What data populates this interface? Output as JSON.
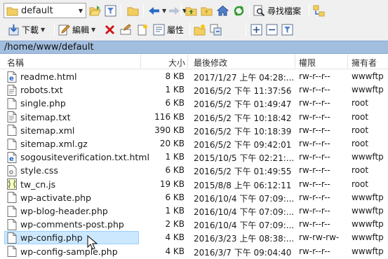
{
  "toolbar1": {
    "path_combo": {
      "value": "default",
      "icon": "folder-icon"
    },
    "search_label": "尋找檔案"
  },
  "toolbar2": {
    "download_label": "下載",
    "edit_label": "編輯",
    "properties_label": "屬性"
  },
  "path": "/home/www/default",
  "columns": {
    "name": "名稱",
    "size": "大小",
    "modified": "最後修改",
    "permissions": "權限",
    "owner": "擁有者"
  },
  "files": [
    {
      "name": "readme.html",
      "icon": "html-file-icon",
      "size": "8 KB",
      "modified": "2017/1/27 上午 04:28:...",
      "permissions": "rw-r--r--",
      "owner": "wwwftp"
    },
    {
      "name": "robots.txt",
      "icon": "text-file-icon",
      "size": "1 KB",
      "modified": "2016/5/2 下午 11:37:56",
      "permissions": "rw-r--r--",
      "owner": "wwwftp"
    },
    {
      "name": "single.php",
      "icon": "file-icon",
      "size": "6 KB",
      "modified": "2016/5/2 下午 01:49:47",
      "permissions": "rw-r--r--",
      "owner": "root"
    },
    {
      "name": "sitemap.txt",
      "icon": "text-file-icon",
      "size": "116 KB",
      "modified": "2016/5/2 下午 10:18:42",
      "permissions": "rw-r--r--",
      "owner": "root"
    },
    {
      "name": "sitemap.xml",
      "icon": "file-icon",
      "size": "390 KB",
      "modified": "2016/5/2 下午 10:18:39",
      "permissions": "rw-r--r--",
      "owner": "root"
    },
    {
      "name": "sitemap.xml.gz",
      "icon": "file-icon",
      "size": "20 KB",
      "modified": "2016/5/2 下午 09:42:01",
      "permissions": "rw-r--r--",
      "owner": "root"
    },
    {
      "name": "sogousiteverification.txt.html",
      "icon": "html-file-icon",
      "size": "1 KB",
      "modified": "2015/10/5 下午 02:21:...",
      "permissions": "rw-r--r--",
      "owner": "wwwftp"
    },
    {
      "name": "style.css",
      "icon": "css-file-icon",
      "size": "6 KB",
      "modified": "2016/5/2 下午 01:49:55",
      "permissions": "rw-r--r--",
      "owner": "root"
    },
    {
      "name": "tw_cn.js",
      "icon": "script-file-icon",
      "size": "19 KB",
      "modified": "2015/8/8 上午 06:12:11",
      "permissions": "rw-r--r--",
      "owner": "root"
    },
    {
      "name": "wp-activate.php",
      "icon": "file-icon",
      "size": "6 KB",
      "modified": "2016/10/4 下午 07:09:...",
      "permissions": "rw-r--r--",
      "owner": "wwwftp"
    },
    {
      "name": "wp-blog-header.php",
      "icon": "file-icon",
      "size": "1 KB",
      "modified": "2016/10/4 下午 07:09:...",
      "permissions": "rw-r--r--",
      "owner": "wwwftp"
    },
    {
      "name": "wp-comments-post.php",
      "icon": "file-icon",
      "size": "2 KB",
      "modified": "2016/10/4 下午 07:09:...",
      "permissions": "rw-r--r--",
      "owner": "wwwftp"
    },
    {
      "name": "wp-config.php",
      "icon": "file-icon",
      "size": "4 KB",
      "modified": "2016/3/23 上午 08:38:...",
      "permissions": "rw-rw-rw-",
      "owner": "wwwftp",
      "selected": true
    },
    {
      "name": "wp-config-sample.php",
      "icon": "file-icon",
      "size": "4 KB",
      "modified": "2016/3/7 下午 09:04:40",
      "permissions": "rw-r--r--",
      "owner": "wwwftp"
    }
  ],
  "colors": {
    "path_bar": "#a2bedf",
    "selection": "#cce8ff",
    "accent_blue": "#2a6ac8"
  }
}
